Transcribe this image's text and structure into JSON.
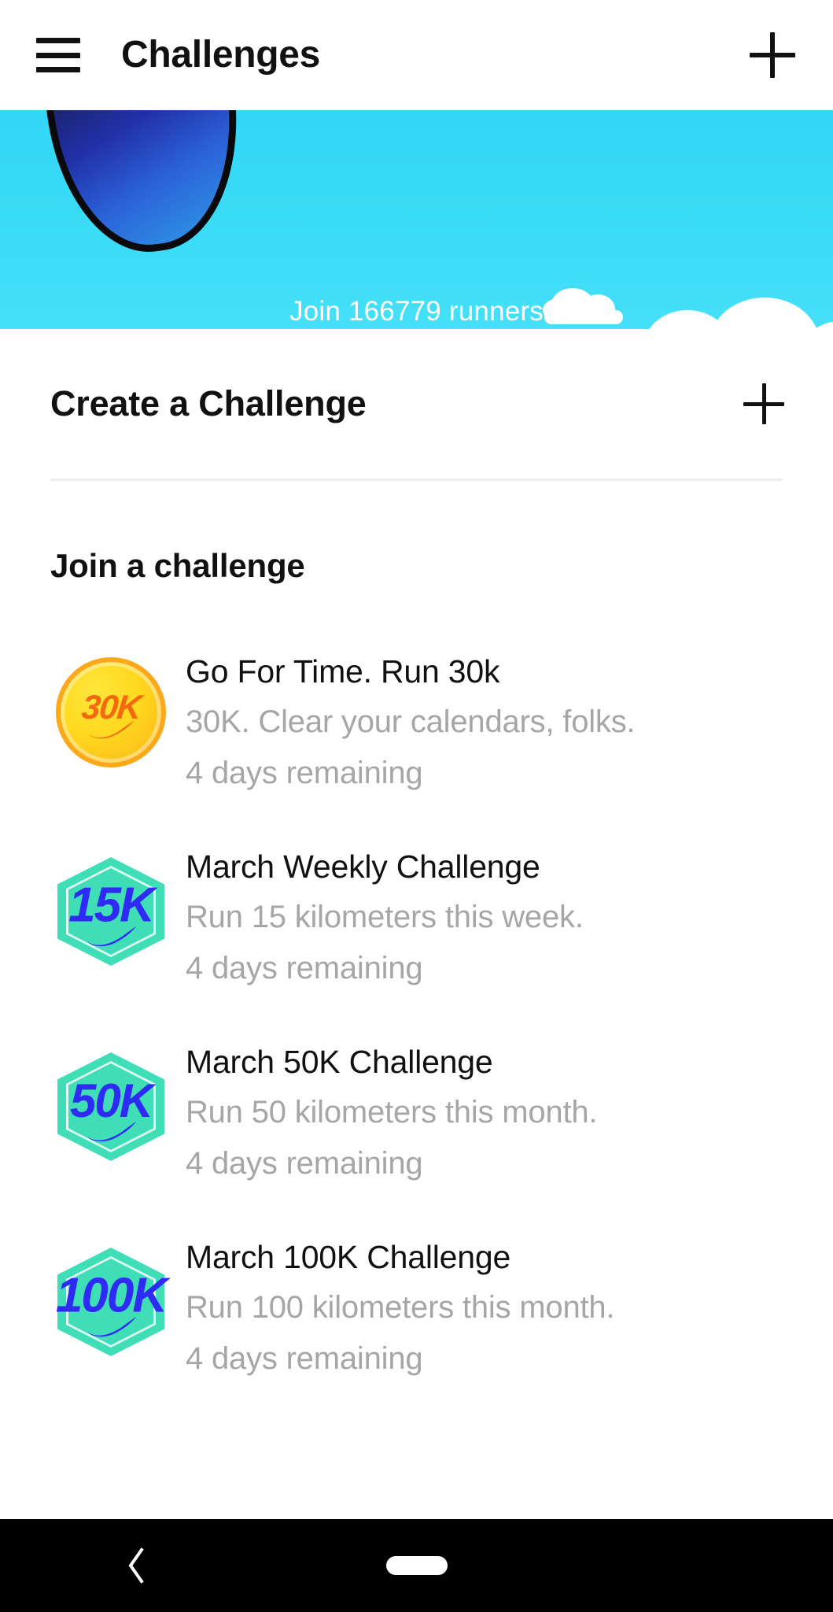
{
  "header": {
    "menu_icon": "hamburger-menu-icon",
    "title": "Challenges",
    "add_icon": "plus-icon"
  },
  "banner": {
    "text": "Join 166779 runners",
    "sky_color": "#36D7F4",
    "cloud_color": "#FFFFFF",
    "shoe_colors": [
      "#0b1230",
      "#2230a8",
      "#2f9de8"
    ]
  },
  "create_section": {
    "label": "Create a Challenge",
    "add_icon": "plus-icon"
  },
  "join_section": {
    "heading": "Join a challenge",
    "items": [
      {
        "badge_label": "30K",
        "badge_shape": "coin",
        "badge_color": "#FFD91F",
        "badge_text_color": "#F4680F",
        "title": "Go For Time. Run 30k",
        "description": "30K. Clear your calendars, folks.",
        "meta": "4 days remaining"
      },
      {
        "badge_label": "15K",
        "badge_shape": "hexagon",
        "badge_color": "#3FDEB7",
        "badge_text_color": "#2F2BF5",
        "title": "March Weekly Challenge",
        "description": "Run 15 kilometers this week.",
        "meta": "4 days remaining"
      },
      {
        "badge_label": "50K",
        "badge_shape": "hexagon",
        "badge_color": "#3FDEB7",
        "badge_text_color": "#2F2BF5",
        "title": "March 50K Challenge",
        "description": "Run 50 kilometers this month.",
        "meta": "4 days remaining"
      },
      {
        "badge_label": "100K",
        "badge_shape": "hexagon",
        "badge_color": "#3FDEB7",
        "badge_text_color": "#2F2BF5",
        "title": "March 100K Challenge",
        "description": "Run 100 kilometers this month.",
        "meta": "4 days remaining"
      }
    ]
  },
  "navbar": {
    "back_icon": "back-chevron-icon",
    "home_icon": "home-pill-icon",
    "background": "#000000"
  }
}
